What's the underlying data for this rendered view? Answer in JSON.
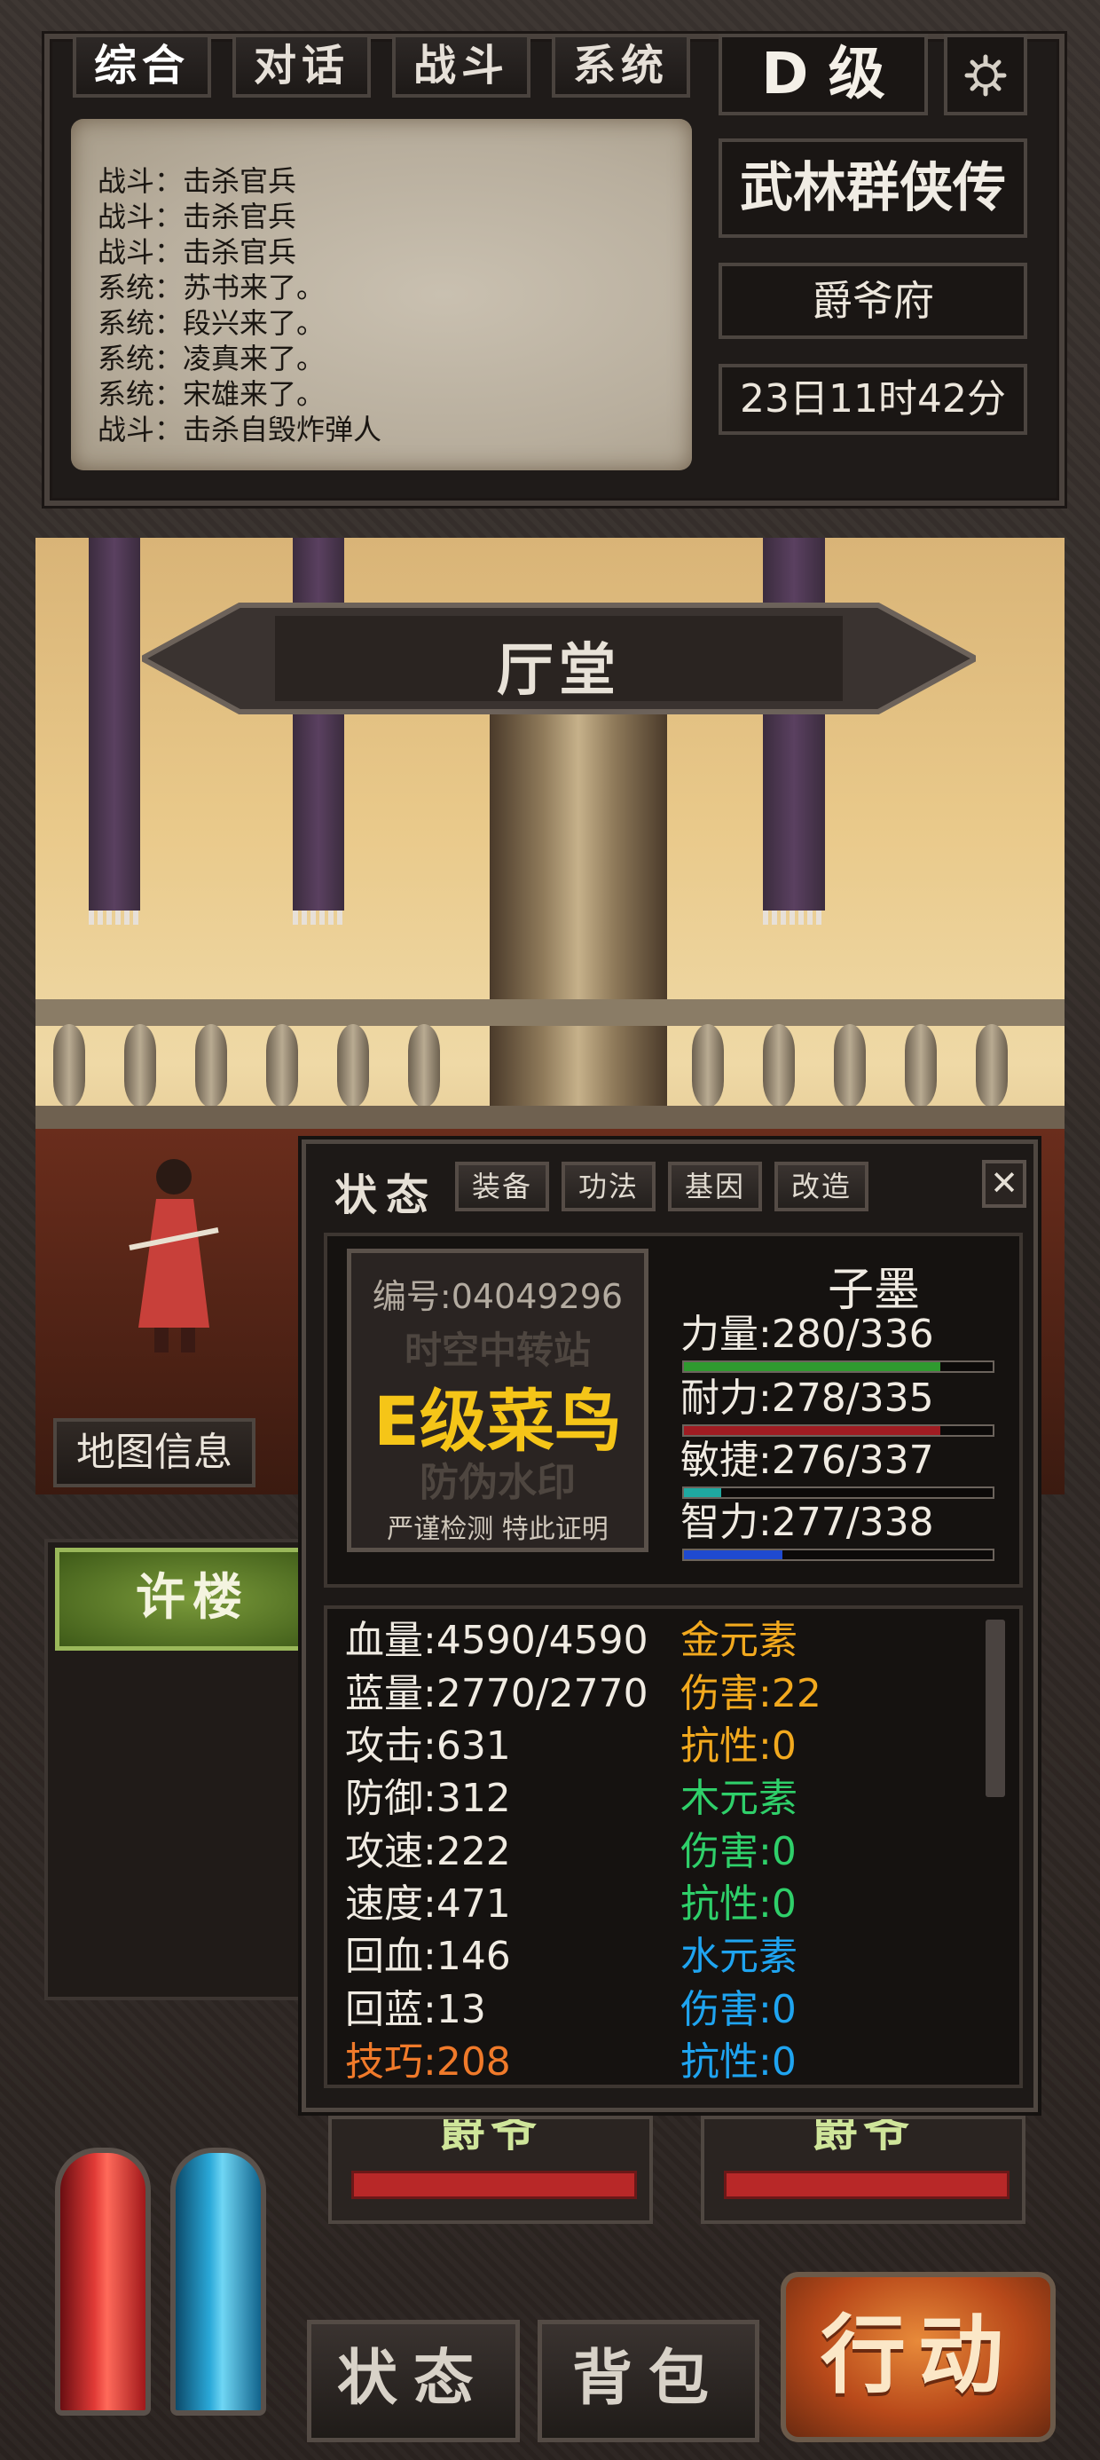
{
  "tabs": [
    "综合",
    "对话",
    "战斗",
    "系统"
  ],
  "grade": "D 级",
  "game_title": "武林群侠传",
  "location": "爵爷府",
  "time": "23日11时42分",
  "log": [
    "战斗：击杀官兵",
    "战斗：击杀官兵",
    "战斗：击杀官兵",
    "系统：苏书来了。",
    "系统：段兴来了。",
    "系统：凌真来了。",
    "系统：宋雄来了。",
    "战斗：击杀自毁炸弹人"
  ],
  "scene_title": "厅堂",
  "map_info": "地图信息",
  "npc_list": [
    "许楼"
  ],
  "status": {
    "title": "状态",
    "tabs": [
      "装备",
      "功法",
      "基因",
      "改造"
    ],
    "close": "✕",
    "stamp": {
      "code": "编号:04049296",
      "line2": "时空中转站",
      "main": "E级菜鸟",
      "line4": "防伪水印",
      "foot": "严谨检测 特此证明"
    },
    "name": "子墨",
    "attributes": [
      {
        "label": "力量:280/336",
        "fraction": 0.83,
        "color": "#2f9a2f"
      },
      {
        "label": "耐力:278/335",
        "fraction": 0.83,
        "color": "#a01c22"
      },
      {
        "label": "敏捷:276/337",
        "fraction": 0.12,
        "color": "#1fa8a0"
      },
      {
        "label": "智力:277/338",
        "fraction": 0.32,
        "color": "#1f4ad0"
      }
    ],
    "stats_left": [
      {
        "text": "血量:4590/4590",
        "color": "#f0ebe2"
      },
      {
        "text": "蓝量:2770/2770",
        "color": "#f0ebe2"
      },
      {
        "text": "攻击:631",
        "color": "#f0ebe2"
      },
      {
        "text": "防御:312",
        "color": "#f0ebe2"
      },
      {
        "text": "攻速:222",
        "color": "#f0ebe2"
      },
      {
        "text": "速度:471",
        "color": "#f0ebe2"
      },
      {
        "text": "回血:146",
        "color": "#f0ebe2"
      },
      {
        "text": "回蓝:13",
        "color": "#f0ebe2"
      },
      {
        "text": "技巧:208",
        "color": "#f07a2a"
      }
    ],
    "stats_right": [
      {
        "text": "金元素",
        "color": "#f2a91e"
      },
      {
        "text": "伤害:22",
        "color": "#f2a91e"
      },
      {
        "text": "抗性:0",
        "color": "#f2a91e"
      },
      {
        "text": "木元素",
        "color": "#2fd06a"
      },
      {
        "text": "伤害:0",
        "color": "#2fd06a"
      },
      {
        "text": "抗性:0",
        "color": "#2fd06a"
      },
      {
        "text": "水元素",
        "color": "#1fa4f0"
      },
      {
        "text": "伤害:0",
        "color": "#1fa4f0"
      },
      {
        "text": "抗性:0",
        "color": "#1fa4f0"
      }
    ]
  },
  "npc_cards": [
    "爵爷",
    "爵爷"
  ],
  "bottom": {
    "status_btn": "状态",
    "bag_btn": "背包",
    "action_btn": "行动"
  }
}
